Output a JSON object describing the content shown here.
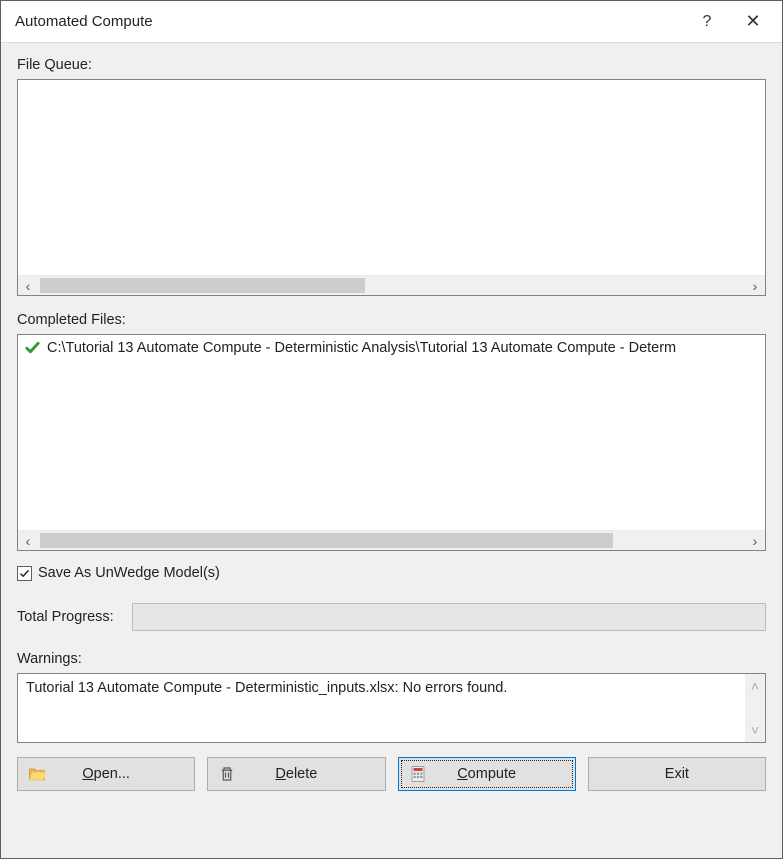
{
  "window": {
    "title": "Automated Compute"
  },
  "labels": {
    "file_queue": "File Queue:",
    "completed_files": "Completed Files:",
    "save_as_unwedge": "Save As UnWedge Model(s)",
    "total_progress": "Total Progress:",
    "warnings": "Warnings:"
  },
  "file_queue": {
    "items": []
  },
  "completed_files": {
    "items": [
      {
        "status": "success",
        "path": "C:\\Tutorial 13 Automate Compute - Deterministic Analysis\\Tutorial 13 Automate Compute - Determ"
      }
    ]
  },
  "options": {
    "save_as_unwedge_checked": true
  },
  "progress": {
    "value": 0
  },
  "warnings": {
    "text": "Tutorial 13 Automate Compute - Deterministic_inputs.xlsx: No errors found."
  },
  "buttons": {
    "open": "Open...",
    "delete": "Delete",
    "compute": "Compute",
    "exit": "Exit"
  },
  "scroll_glyphs": {
    "left": "‹",
    "right": "›",
    "up": "˄",
    "down": "˅"
  },
  "titlebar_icons": {
    "help": "?",
    "close": "✕"
  }
}
